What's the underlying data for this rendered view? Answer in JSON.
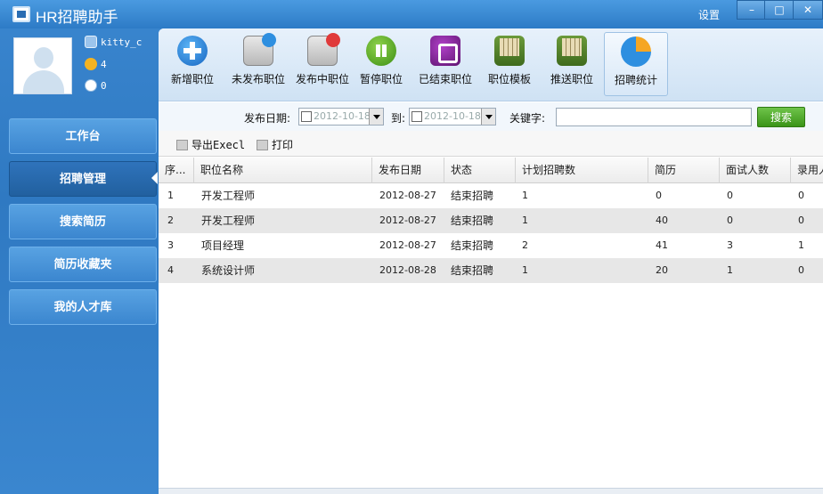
{
  "window": {
    "title": "HR招聘助手",
    "settings_label": "设置",
    "minimize": "–",
    "maximize": "□",
    "close": "✕"
  },
  "user": {
    "username": "kitty_c",
    "coins": "4",
    "messages": "0"
  },
  "nav": {
    "items": [
      {
        "label": "工作台"
      },
      {
        "label": "招聘管理"
      },
      {
        "label": "搜索简历"
      },
      {
        "label": "简历收藏夹"
      },
      {
        "label": "我的人才库"
      }
    ],
    "active_index": 1
  },
  "toolbar": {
    "items": [
      {
        "label": "新增职位",
        "icon": "add-icon"
      },
      {
        "label": "未发布职位",
        "icon": "envelope-check-icon"
      },
      {
        "label": "发布中职位",
        "icon": "envelope-x-icon"
      },
      {
        "label": "暂停职位",
        "icon": "pause-icon"
      },
      {
        "label": "已结束职位",
        "icon": "stop-icon"
      },
      {
        "label": "职位模板",
        "icon": "books-icon"
      },
      {
        "label": "推送职位",
        "icon": "books-arrow-icon"
      },
      {
        "label": "招聘统计",
        "icon": "pie-chart-icon"
      }
    ],
    "selected_index": 7
  },
  "filter": {
    "date_label": "发布日期:",
    "date_from": "2012-10-18",
    "to_label": "到:",
    "date_to": "2012-10-18",
    "keyword_label": "关键字:",
    "keyword_value": "",
    "search_button": "搜索"
  },
  "actions": {
    "export_label": "导出Execl",
    "print_label": "打印"
  },
  "table": {
    "columns": [
      "序...",
      "职位名称",
      "发布日期",
      "状态",
      "计划招聘数",
      "简历",
      "面试人数",
      "录用人"
    ],
    "rows": [
      [
        "1",
        "开发工程师",
        "2012-08-27",
        "结束招聘",
        "1",
        "0",
        "0",
        "0"
      ],
      [
        "2",
        "开发工程师",
        "2012-08-27",
        "结束招聘",
        "1",
        "40",
        "0",
        "0"
      ],
      [
        "3",
        "项目经理",
        "2012-08-27",
        "结束招聘",
        "2",
        "41",
        "3",
        "1"
      ],
      [
        "4",
        "系统设计师",
        "2012-08-28",
        "结束招聘",
        "1",
        "20",
        "1",
        "0"
      ]
    ]
  },
  "colors": {
    "brand_blue": "#2f79c2",
    "nav_active": "#21609f",
    "search_green": "#3a9419"
  }
}
